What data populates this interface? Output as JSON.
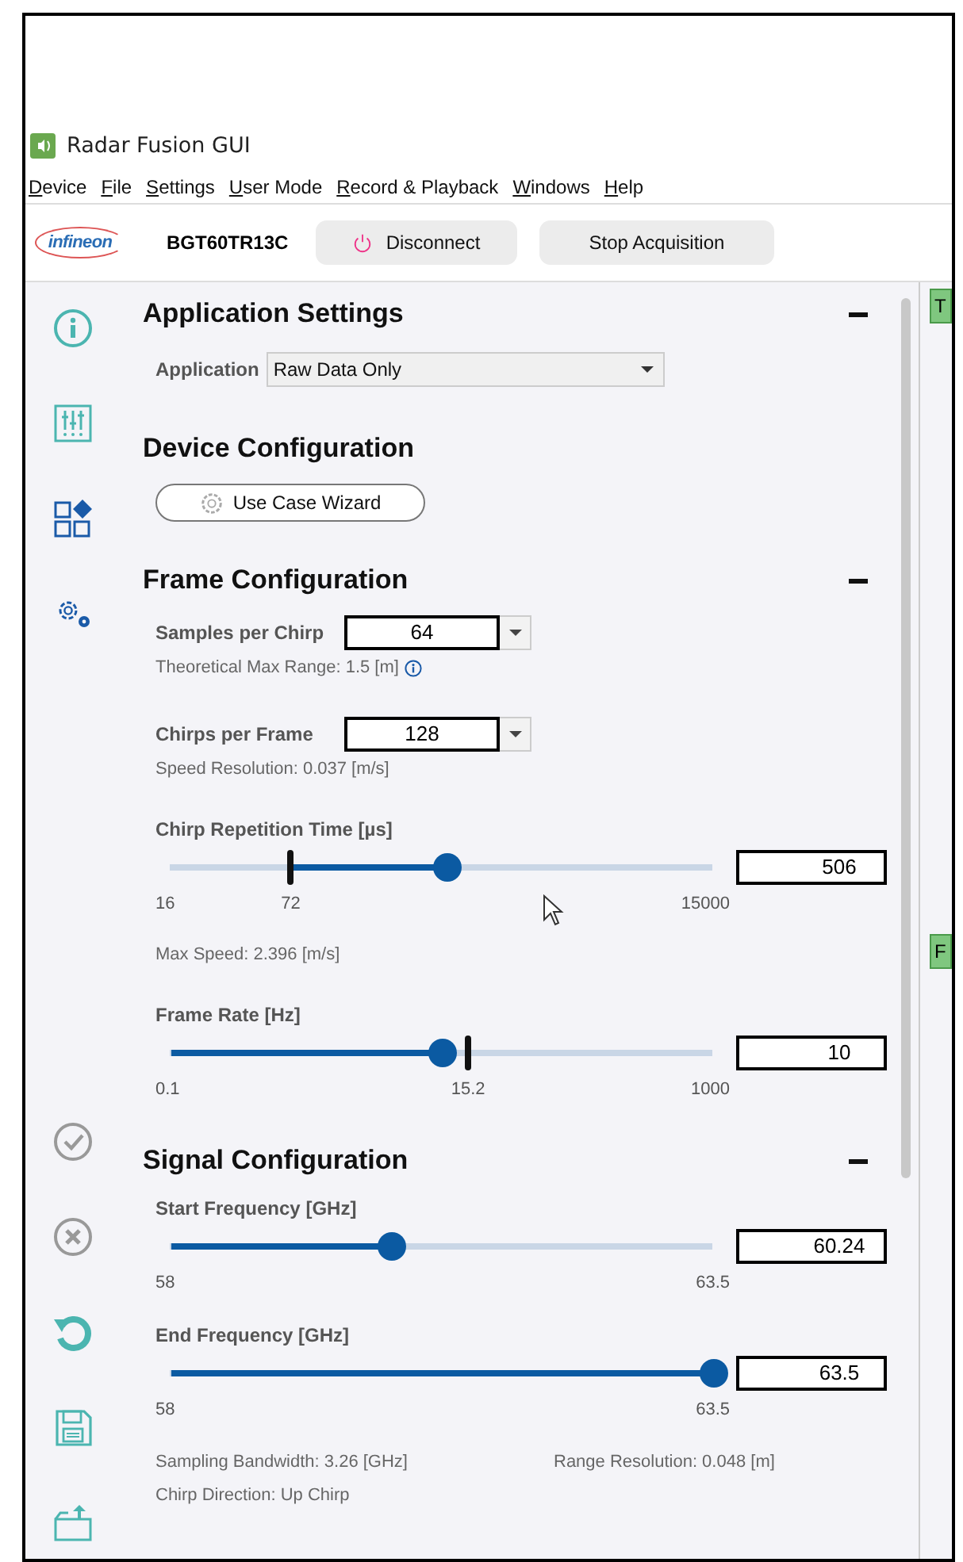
{
  "app": {
    "title": "Radar Fusion GUI"
  },
  "menu": [
    {
      "label": "Device"
    },
    {
      "label": "File"
    },
    {
      "label": "Settings"
    },
    {
      "label": "User Mode"
    },
    {
      "label": "Record & Playback"
    },
    {
      "label": "Windows"
    },
    {
      "label": "Help"
    }
  ],
  "toolbar": {
    "logo": "infineon",
    "device": "BGT60TR13C",
    "buttons": [
      {
        "kind": "power",
        "label": "Disconnect"
      },
      {
        "kind": "plain",
        "label": "Stop Acquisition"
      }
    ]
  },
  "sidebar": {
    "top": [
      {
        "kind": "info",
        "disabled": false
      },
      {
        "kind": "sliders",
        "disabled": false
      },
      {
        "kind": "modules",
        "disabled": false
      },
      {
        "kind": "gears",
        "disabled": false
      }
    ],
    "bottom": [
      {
        "kind": "check",
        "disabled": true
      },
      {
        "kind": "cancel",
        "disabled": true
      },
      {
        "kind": "reset",
        "disabled": false
      },
      {
        "kind": "save",
        "disabled": false
      },
      {
        "kind": "export",
        "disabled": false
      }
    ]
  },
  "sections": [
    {
      "title": "Application Settings",
      "collapsible": true,
      "items": [
        {
          "kind": "select",
          "label": "Application",
          "value": "Raw Data Only"
        }
      ]
    },
    {
      "title": "Device Configuration",
      "collapsible": false,
      "items": [
        {
          "kind": "button",
          "label": "Use Case Wizard"
        }
      ]
    },
    {
      "title": "Frame Configuration",
      "collapsible": true,
      "items": [
        {
          "kind": "combo",
          "label": "Samples per Chirp",
          "value": "64"
        },
        {
          "kind": "note",
          "text": "Theoretical Max Range: 1.5 [m]",
          "info": true
        },
        {
          "kind": "combo",
          "label": "Chirps per Frame",
          "value": "128"
        },
        {
          "kind": "note",
          "text": "Speed Resolution: 0.037 [m/s]",
          "info": false
        },
        {
          "kind": "slider",
          "label": "Chirp Repetition Time [µs]",
          "level": 0.51,
          "value": "506",
          "min": "16",
          "max": "15000",
          "marker": {
            "kind": "lower",
            "label": "72",
            "level": 0.22
          }
        },
        {
          "kind": "note",
          "text": "Max Speed: 2.396 [m/s]",
          "info": false
        },
        {
          "kind": "slider",
          "label": "Frame Rate [Hz]",
          "level": 0.5,
          "value": "10",
          "min": "0.1",
          "max": "1000",
          "marker": {
            "kind": "upper",
            "label": "15.2",
            "level": 0.547
          }
        }
      ]
    },
    {
      "title": "Signal Configuration",
      "collapsible": true,
      "items": [
        {
          "kind": "slider",
          "label": "Start Frequency [GHz]",
          "level": 0.406,
          "value": "60.24",
          "min": "58",
          "max": "63.5"
        },
        {
          "kind": "slider",
          "label": "End Frequency [GHz]",
          "level": 1,
          "value": "63.5",
          "min": "58",
          "max": "63.5"
        },
        {
          "kind": "note_pair",
          "left": "Sampling Bandwidth: 3.26 [GHz]",
          "right": "Range Resolution: 0.048 [m]"
        },
        {
          "kind": "note",
          "text": "Chirp Direction: Up Chirp",
          "info": false
        }
      ]
    }
  ],
  "side_tabs": [
    {
      "label": "T"
    },
    {
      "label": "F"
    }
  ]
}
